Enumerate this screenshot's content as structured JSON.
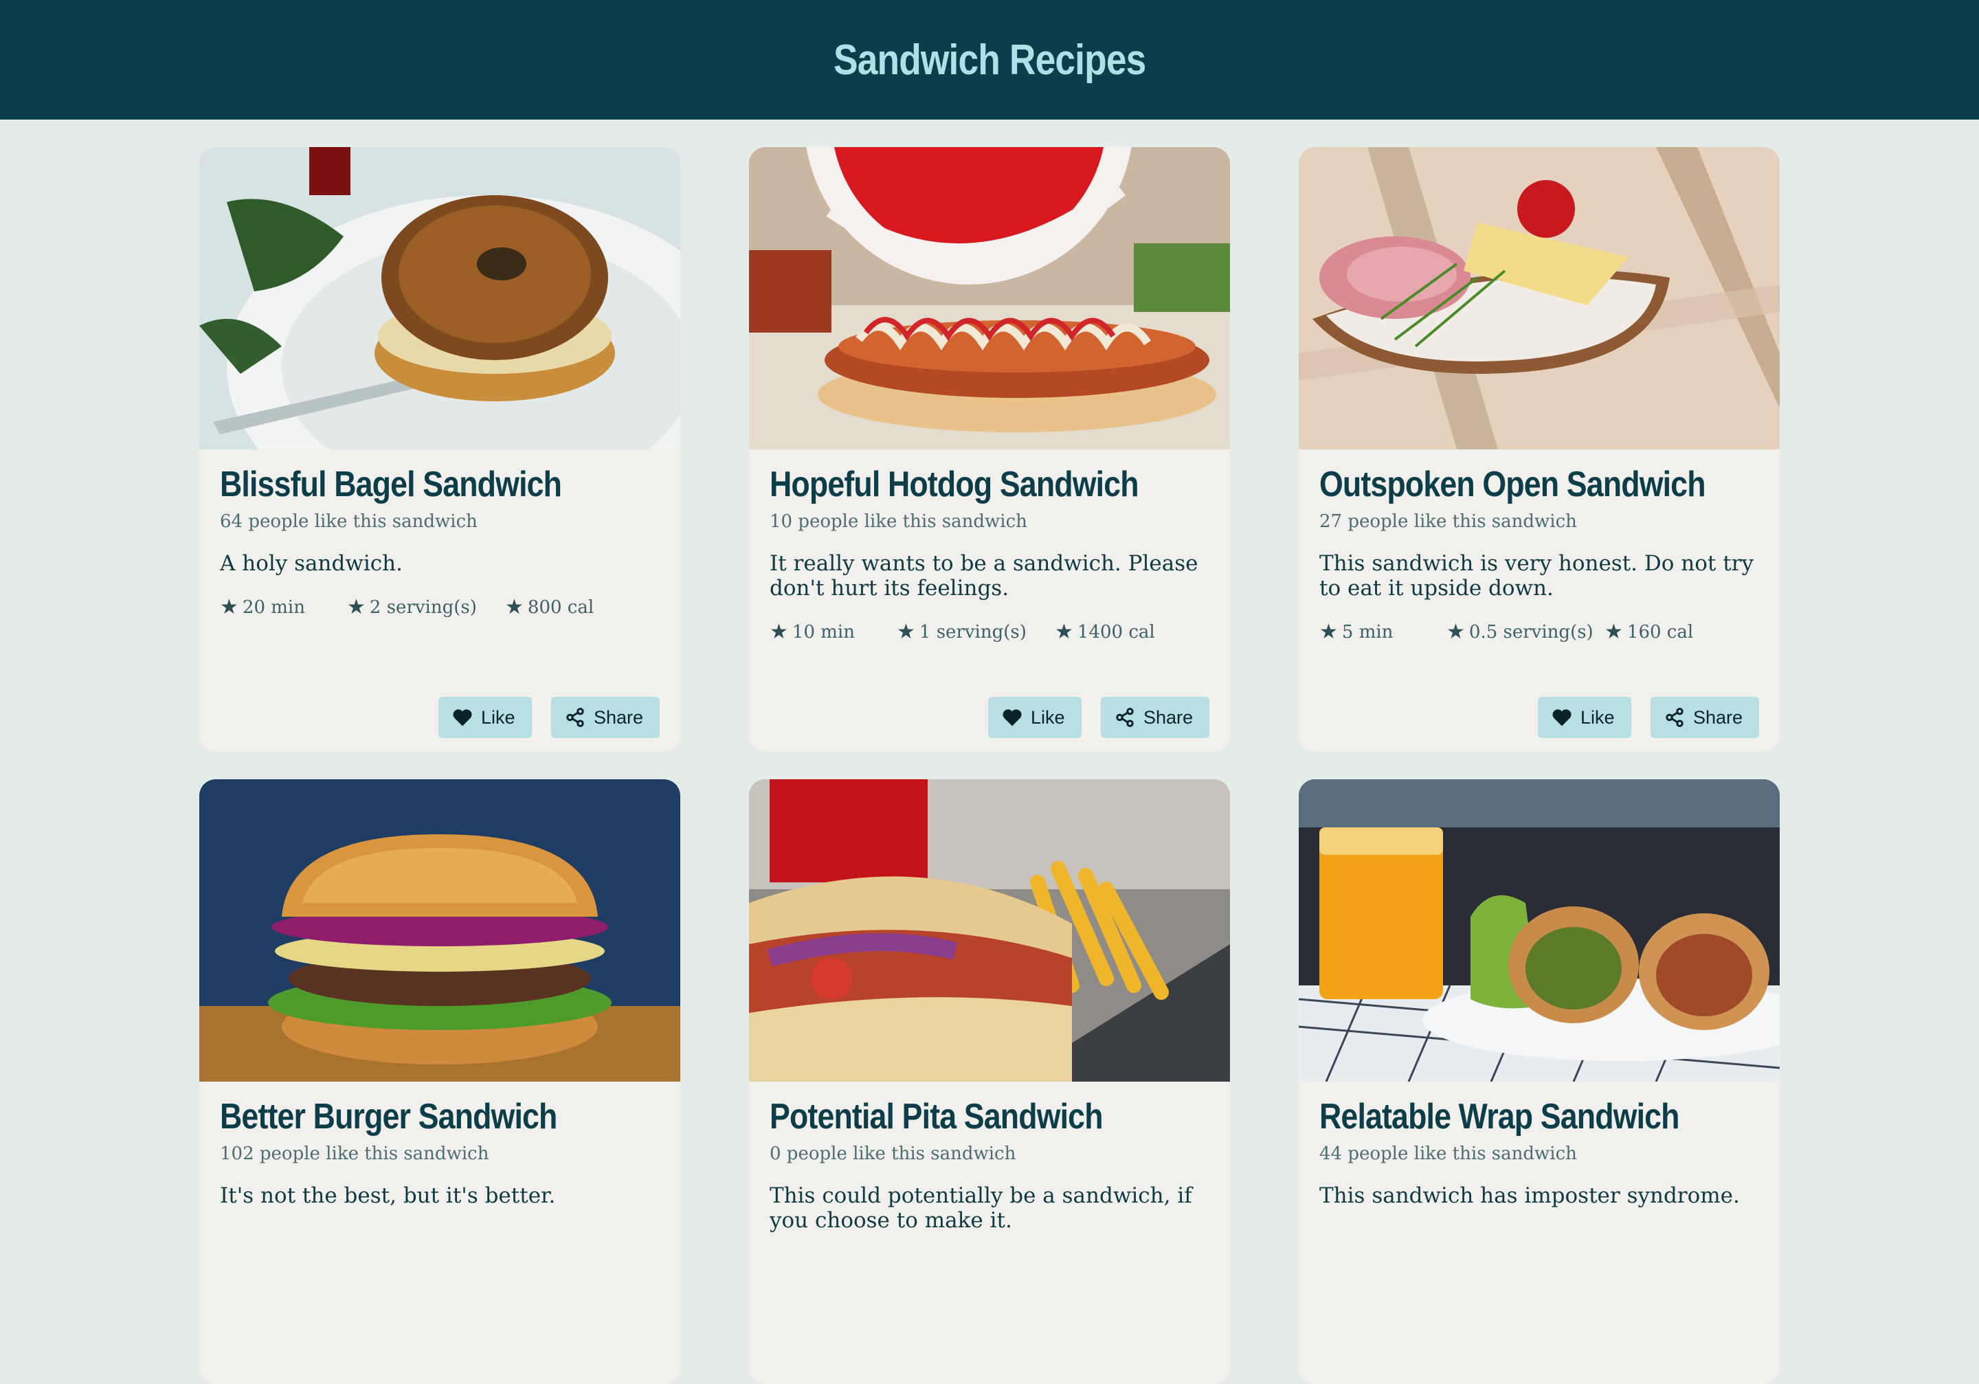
{
  "header": {
    "title": "Sandwich Recipes"
  },
  "cards": [
    {
      "title": "Blissful Bagel Sandwich",
      "likes": "64 people like this sandwich",
      "description": "A holy sandwich.",
      "time": "20 min",
      "servings": "2 serving(s)",
      "calories": "800 cal",
      "like_label": "Like",
      "share_label": "Share"
    },
    {
      "title": "Hopeful Hotdog Sandwich",
      "likes": "10 people like this sandwich",
      "description": "It really wants to be a sandwich. Please don't hurt its feelings.",
      "time": "10 min",
      "servings": "1 serving(s)",
      "calories": "1400 cal",
      "like_label": "Like",
      "share_label": "Share"
    },
    {
      "title": "Outspoken Open Sandwich",
      "likes": "27 people like this sandwich",
      "description": "This sandwich is very honest. Do not try to eat it upside down.",
      "time": "5 min",
      "servings": "0.5 serving(s)",
      "calories": "160 cal",
      "like_label": "Like",
      "share_label": "Share"
    },
    {
      "title": "Better Burger Sandwich",
      "likes": "102 people like this sandwich",
      "description": "It's not the best, but it's better."
    },
    {
      "title": "Potential Pita Sandwich",
      "likes": "0 people like this sandwich",
      "description": "This could potentially be a sandwich, if you choose to make it."
    },
    {
      "title": "Relatable Wrap Sandwich",
      "likes": "44 people like this sandwich",
      "description": "This sandwich has imposter syndrome."
    }
  ],
  "colors": {
    "header_bg": "#083f4a",
    "header_text": "#aee0e6",
    "page_bg": "#e4ecea",
    "card_bg": "#f2f0ed",
    "button_bg": "#b7dfe4",
    "title": "#0c3d48"
  },
  "icons": {
    "meta": "star-icon",
    "like": "heart-icon",
    "share": "share-icon"
  }
}
